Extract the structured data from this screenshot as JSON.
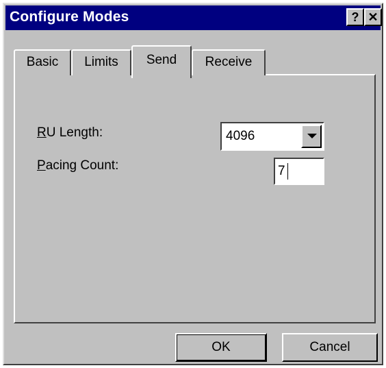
{
  "window": {
    "title": "Configure Modes",
    "help_button": "?",
    "close_button": "✕"
  },
  "tabs": [
    {
      "label": "Basic",
      "active": false
    },
    {
      "label": "Limits",
      "active": false
    },
    {
      "label": "Send",
      "active": true
    },
    {
      "label": "Receive",
      "active": false
    }
  ],
  "fields": {
    "ru_length": {
      "label_mnemonic": "R",
      "label_rest": "U Length:",
      "value": "4096"
    },
    "pacing_count": {
      "label_mnemonic": "P",
      "label_rest": "acing Count:",
      "value": "7"
    }
  },
  "buttons": {
    "ok": "OK",
    "cancel": "Cancel"
  },
  "colors": {
    "titlebar": "#000080",
    "face": "#c0c0c0"
  }
}
